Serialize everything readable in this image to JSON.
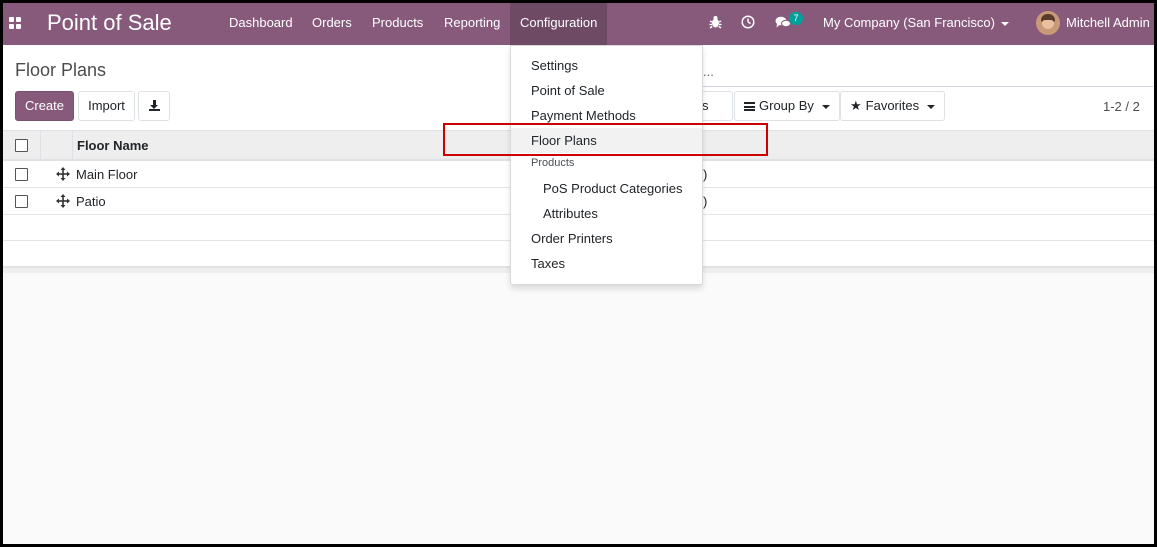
{
  "navbar": {
    "brand": "Point of Sale",
    "menu": [
      {
        "label": "Dashboard"
      },
      {
        "label": "Orders"
      },
      {
        "label": "Products"
      },
      {
        "label": "Reporting"
      },
      {
        "label": "Configuration",
        "active": true
      }
    ],
    "messages_count": "7",
    "company": "My Company (San Francisco)",
    "user": "Mitchell Admin",
    "accent_color": "#875a7b"
  },
  "control_panel": {
    "title": "Floor Plans",
    "search_placeholder": "...",
    "buttons": {
      "create": "Create",
      "import": "Import"
    },
    "filters_label_tail": "s",
    "group_by": "Group By",
    "favorites": "Favorites",
    "pager": "1-2 / 2"
  },
  "table": {
    "header": "Floor Name",
    "rows": [
      {
        "name": "Main Floor",
        "trail": ")"
      },
      {
        "name": "Patio",
        "trail": ")"
      }
    ]
  },
  "config_menu": {
    "items": [
      {
        "label": "Settings"
      },
      {
        "label": "Point of Sale"
      },
      {
        "label": "Payment Methods"
      },
      {
        "label": "Floor Plans",
        "selected": true
      }
    ],
    "section_header": "Products",
    "section_items": [
      {
        "label": "PoS Product Categories"
      },
      {
        "label": "Attributes"
      }
    ],
    "tail_items": [
      {
        "label": "Order Printers"
      },
      {
        "label": "Taxes"
      }
    ]
  }
}
